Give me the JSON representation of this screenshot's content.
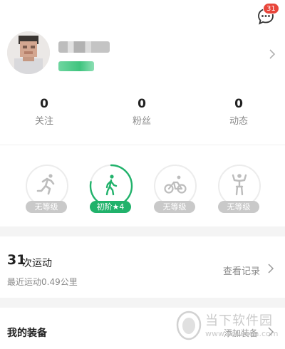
{
  "header": {
    "message_badge_count": "31"
  },
  "profile": {
    "nickname_hidden": true
  },
  "stats": [
    {
      "value": "0",
      "label": "关注"
    },
    {
      "value": "0",
      "label": "粉丝"
    },
    {
      "value": "0",
      "label": "动态"
    }
  ],
  "sports": [
    {
      "icon": "running-icon",
      "level": "无等级",
      "active": false,
      "progress": 0
    },
    {
      "icon": "walking-icon",
      "level": "初阶★4",
      "active": true,
      "progress": 0.78
    },
    {
      "icon": "cycling-icon",
      "level": "无等级",
      "active": false,
      "progress": 0
    },
    {
      "icon": "fitness-icon",
      "level": "无等级",
      "active": false,
      "progress": 0
    }
  ],
  "workouts": {
    "count": "31",
    "unit_label": "次运动",
    "recent_label": "最近运动0.49公里",
    "records_link": "查看记录"
  },
  "gear": {
    "title": "我的装备",
    "add_link": "添加装备"
  },
  "watermark": {
    "text": "当下软件园",
    "url": "www.downxia.com"
  },
  "colors": {
    "accent_green": "#21b26b",
    "badge_red": "#e8463b",
    "inactive_gray": "#c9c9c9"
  }
}
